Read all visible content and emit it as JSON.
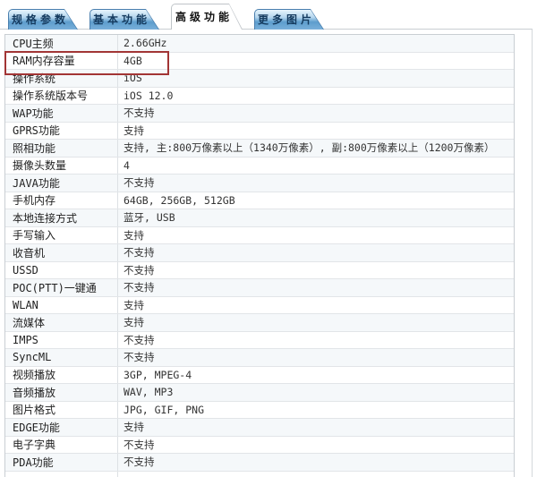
{
  "tabs": [
    {
      "label": "规格参数",
      "active": false
    },
    {
      "label": "基本功能",
      "active": false
    },
    {
      "label": "高级功能",
      "active": true
    },
    {
      "label": "更多图片",
      "active": false
    }
  ],
  "table": {
    "rows": [
      {
        "label": "CPU主频",
        "value": "2.66GHz",
        "highlight": false
      },
      {
        "label": "RAM内存容量",
        "value": "4GB",
        "highlight": true
      },
      {
        "label": "操作系统",
        "value": "iOS",
        "highlight": false
      },
      {
        "label": "操作系统版本号",
        "value": "iOS 12.0",
        "highlight": false
      },
      {
        "label": "WAP功能",
        "value": "不支持",
        "highlight": false
      },
      {
        "label": "GPRS功能",
        "value": "支持",
        "highlight": false
      },
      {
        "label": "照相功能",
        "value": "支持, 主:800万像素以上（1340万像素）, 副:800万像素以上（1200万像素）",
        "highlight": false
      },
      {
        "label": "摄像头数量",
        "value": "4",
        "highlight": false
      },
      {
        "label": "JAVA功能",
        "value": "不支持",
        "highlight": false
      },
      {
        "label": "手机内存",
        "value": "64GB, 256GB, 512GB",
        "highlight": false
      },
      {
        "label": "本地连接方式",
        "value": "蓝牙, USB",
        "highlight": false
      },
      {
        "label": "手写输入",
        "value": "支持",
        "highlight": false
      },
      {
        "label": "收音机",
        "value": "不支持",
        "highlight": false
      },
      {
        "label": "USSD",
        "value": "不支持",
        "highlight": false
      },
      {
        "label": "POC(PTT)一键通",
        "value": "不支持",
        "highlight": false
      },
      {
        "label": "WLAN",
        "value": "支持",
        "highlight": false
      },
      {
        "label": "流媒体",
        "value": "支持",
        "highlight": false
      },
      {
        "label": "IMPS",
        "value": "不支持",
        "highlight": false
      },
      {
        "label": "SyncML",
        "value": "不支持",
        "highlight": false
      },
      {
        "label": "视频播放",
        "value": "3GP, MPEG-4",
        "highlight": false
      },
      {
        "label": "音频播放",
        "value": "WAV, MP3",
        "highlight": false
      },
      {
        "label": "图片格式",
        "value": "JPG, GIF, PNG",
        "highlight": false
      },
      {
        "label": "EDGE功能",
        "value": "支持",
        "highlight": false
      },
      {
        "label": "电子字典",
        "value": "不支持",
        "highlight": false
      },
      {
        "label": "PDA功能",
        "value": "不支持",
        "highlight": false
      }
    ]
  },
  "colors": {
    "highlight_box": "#a23535",
    "tab_outline": "#4a7fae",
    "tab_text": "#143a5e",
    "tab_gradient_top": "#e7f4fc",
    "tab_gradient_bottom": "#79b0da",
    "active_tab_bg": "#ffffff",
    "row_alt_bg": "#f5f8fa",
    "row_border": "#e2e5e8",
    "table_border": "#c9ced3",
    "panel_border": "#c9ced2"
  }
}
